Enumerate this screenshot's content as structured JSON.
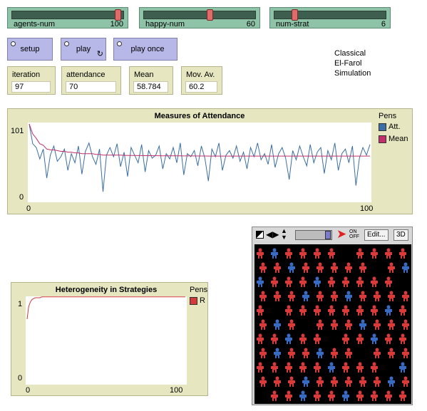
{
  "sliders": [
    {
      "label": "agents-num",
      "value": "100",
      "fraction": 0.98
    },
    {
      "label": "happy-num",
      "value": "60",
      "fraction": 0.6
    },
    {
      "label": "num-strat",
      "value": "6",
      "fraction": 0.17
    }
  ],
  "buttons": {
    "setup": "setup",
    "play": "play",
    "play_once": "play once",
    "forever_glyph": "↻"
  },
  "note": {
    "line1": "Classical",
    "line2": "El-Farol",
    "line3": "Simulation"
  },
  "monitors": [
    {
      "label": "iteration",
      "value": "97"
    },
    {
      "label": "attendance",
      "value": "70"
    },
    {
      "label": "Mean",
      "value": "58.784"
    },
    {
      "label": "Mov. Av.",
      "value": "60.2"
    }
  ],
  "plot1": {
    "title": "Measures of Attendance",
    "ymax_label": "101",
    "ymin_label": "0",
    "xmin_label": "0",
    "xmax_label": "100",
    "pens_title": "Pens",
    "pen1": "Att.",
    "pen2": "Mean"
  },
  "plot2": {
    "title": "Heterogeneity in Strategies",
    "ymax_label": "1",
    "ymin_label": "0",
    "xmin_label": "0",
    "xmax_label": "100",
    "pens_title": "Pens",
    "pen1": "R"
  },
  "view_toolbar": {
    "edit": "Edit...",
    "three_d": "3D",
    "on": "ON",
    "off": "OFF"
  },
  "colors": {
    "att": "#3a6ea5",
    "mean": "#c0306a",
    "r": "#d23b3b",
    "agent_red": "#d93a3a",
    "agent_blue": "#3a6bc2"
  },
  "chart_data": [
    {
      "type": "line",
      "title": "Measures of Attendance",
      "xlim": [
        0,
        100
      ],
      "ylim": [
        0,
        101
      ],
      "series": [
        {
          "name": "Att.",
          "values": [
            101,
            75,
            70,
            55,
            68,
            30,
            60,
            72,
            52,
            58,
            68,
            40,
            62,
            50,
            72,
            35,
            65,
            76,
            58,
            48,
            68,
            12,
            60,
            70,
            58,
            75,
            45,
            64,
            32,
            70,
            60,
            50,
            74,
            38,
            66,
            56,
            60,
            72,
            42,
            62,
            55,
            70,
            50,
            76,
            34,
            62,
            58,
            66,
            46,
            72,
            56,
            26,
            68,
            58,
            76,
            40,
            60,
            66,
            56,
            72,
            52,
            64,
            42,
            70,
            58,
            76,
            54,
            62,
            48,
            74,
            44,
            62,
            70,
            56,
            28,
            66,
            54,
            72,
            58,
            46,
            74,
            50,
            64,
            70,
            36,
            66,
            54,
            76,
            40,
            62,
            68,
            50,
            72,
            20,
            56,
            70,
            60,
            74
          ]
        },
        {
          "name": "Mean",
          "values": [
            101,
            88,
            82,
            75,
            73,
            68,
            67,
            67,
            66,
            65,
            65,
            64,
            64,
            63,
            63,
            62,
            62,
            62,
            62,
            61,
            61,
            60,
            60,
            60,
            60,
            60,
            60,
            59.8,
            59.6,
            59.6,
            59.6,
            59.5,
            59.5,
            59.4,
            59.4,
            59.3,
            59.3,
            59.3,
            59.2,
            59.2,
            59.1,
            59.1,
            59.1,
            59.1,
            59.0,
            59.0,
            59.0,
            59.0,
            58.9,
            58.9,
            58.9,
            58.8,
            58.8,
            58.8,
            58.8,
            58.8,
            58.8,
            58.8,
            58.8,
            58.8,
            58.8,
            58.8,
            58.8,
            58.8,
            58.8,
            58.8,
            58.8,
            58.8,
            58.8,
            58.8,
            58.8,
            58.8,
            58.8,
            58.8,
            58.8,
            58.8,
            58.8,
            58.8,
            58.8,
            58.8,
            58.8,
            58.8,
            58.8,
            58.8,
            58.8,
            58.8,
            58.8,
            58.8,
            58.8,
            58.8,
            58.8,
            58.8,
            58.8,
            58.8,
            58.8,
            58.8,
            58.8,
            58.784
          ]
        }
      ]
    },
    {
      "type": "line",
      "title": "Heterogeneity in Strategies",
      "xlim": [
        0,
        100
      ],
      "ylim": [
        0,
        1
      ],
      "series": [
        {
          "name": "R",
          "values": [
            0.75,
            0.9,
            0.95,
            0.98,
            0.99,
            1.0,
            1.0,
            1.0,
            1.0,
            1.01,
            1.01,
            1.01,
            1.01,
            1.01,
            1.01,
            1.01,
            1.01,
            1.01,
            1.01,
            1.01,
            1.01,
            1.01,
            1.01,
            1.01,
            1.01,
            1.01,
            1.01,
            1.01,
            1.01,
            1.01,
            1.01,
            1.01,
            1.01,
            1.01,
            1.01,
            1.01,
            1.01,
            1.01,
            1.01,
            1.01,
            1.01,
            1.01,
            1.01,
            1.01,
            1.01,
            1.01,
            1.01,
            1.01,
            1.01,
            1.01,
            1.01,
            1.01,
            1.01,
            1.01,
            1.01,
            1.01,
            1.01,
            1.01,
            1.01,
            1.01,
            1.01,
            1.01,
            1.01,
            1.01,
            1.01,
            1.01,
            1.01,
            1.01,
            1.01,
            1.01,
            1.01,
            1.01,
            1.01,
            1.01,
            1.01,
            1.01,
            1.01,
            1.01,
            1.01,
            1.01,
            1.01,
            1.01,
            1.01,
            1.01,
            1.01,
            1.01,
            1.01,
            1.01,
            1.01,
            1.01,
            1.01,
            1.01,
            1.01,
            1.01,
            1.01,
            1.01,
            1.01,
            1.01
          ]
        }
      ]
    }
  ]
}
